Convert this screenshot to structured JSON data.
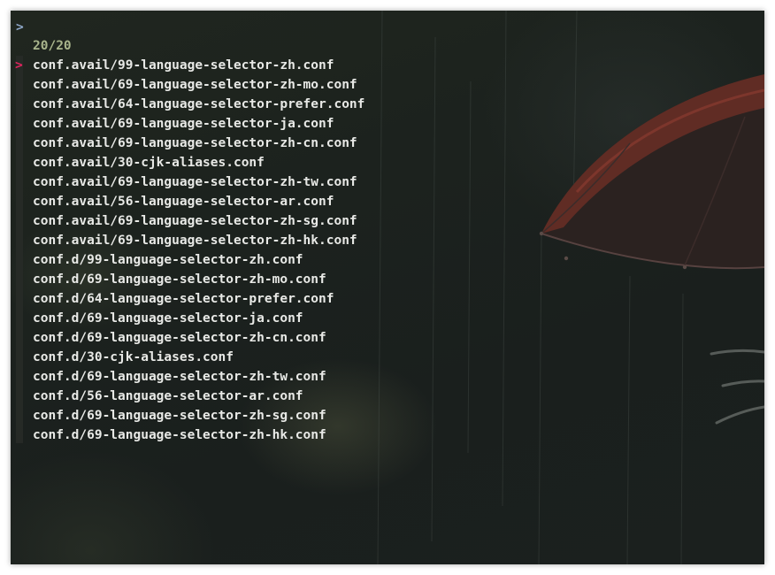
{
  "terminal": {
    "prompt": ">",
    "counter": "20/20",
    "pointer": ">",
    "selected_index": 0,
    "items": [
      "conf.avail/99-language-selector-zh.conf",
      "conf.avail/69-language-selector-zh-mo.conf",
      "conf.avail/64-language-selector-prefer.conf",
      "conf.avail/69-language-selector-ja.conf",
      "conf.avail/69-language-selector-zh-cn.conf",
      "conf.avail/30-cjk-aliases.conf",
      "conf.avail/69-language-selector-zh-tw.conf",
      "conf.avail/56-language-selector-ar.conf",
      "conf.avail/69-language-selector-zh-sg.conf",
      "conf.avail/69-language-selector-zh-hk.conf",
      "conf.d/99-language-selector-zh.conf",
      "conf.d/69-language-selector-zh-mo.conf",
      "conf.d/64-language-selector-prefer.conf",
      "conf.d/69-language-selector-ja.conf",
      "conf.d/69-language-selector-zh-cn.conf",
      "conf.d/30-cjk-aliases.conf",
      "conf.d/69-language-selector-zh-tw.conf",
      "conf.d/56-language-selector-ar.conf",
      "conf.d/69-language-selector-zh-sg.conf",
      "conf.d/69-language-selector-zh-hk.conf"
    ]
  },
  "theme": {
    "prompt_color": "#8fa7c8",
    "counter_color": "#a9b58c",
    "pointer_color": "#e0245e",
    "text_color": "#e8e9e6"
  },
  "wallpaper": {
    "subject": "umbrella-in-rain"
  }
}
